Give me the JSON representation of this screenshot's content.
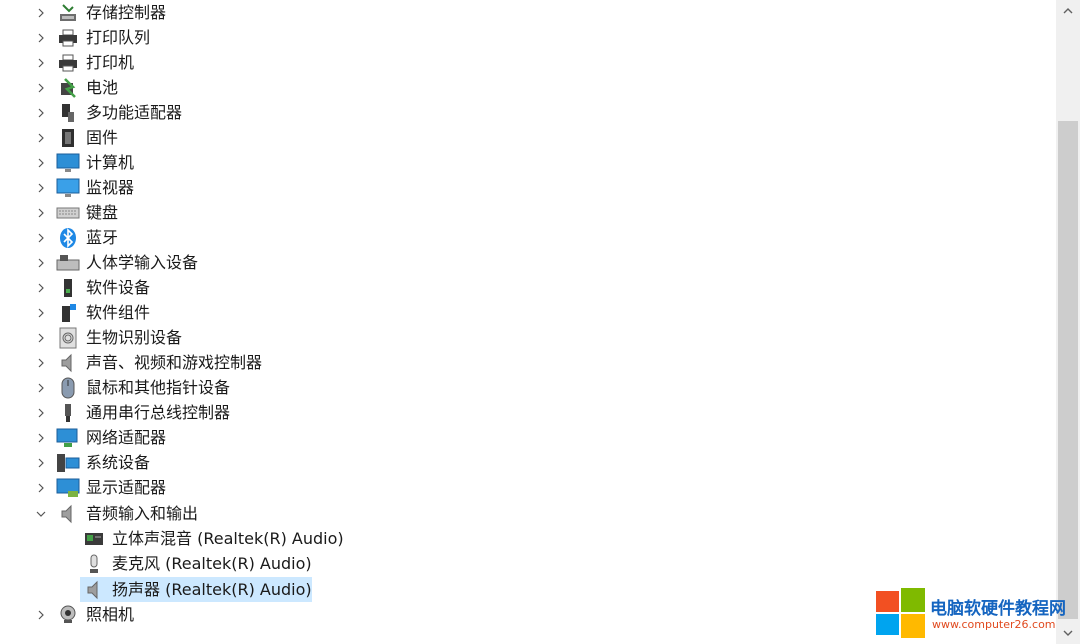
{
  "device_tree": {
    "categories": [
      {
        "label": "存储控制器",
        "icon": "storage-controller-icon",
        "expanded": false
      },
      {
        "label": "打印队列",
        "icon": "printer-icon",
        "expanded": false
      },
      {
        "label": "打印机",
        "icon": "printer-icon",
        "expanded": false
      },
      {
        "label": "电池",
        "icon": "battery-icon",
        "expanded": false
      },
      {
        "label": "多功能适配器",
        "icon": "multifunction-adapter-icon",
        "expanded": false
      },
      {
        "label": "固件",
        "icon": "firmware-icon",
        "expanded": false
      },
      {
        "label": "计算机",
        "icon": "computer-icon",
        "expanded": false
      },
      {
        "label": "监视器",
        "icon": "monitor-icon",
        "expanded": false
      },
      {
        "label": "键盘",
        "icon": "keyboard-icon",
        "expanded": false
      },
      {
        "label": "蓝牙",
        "icon": "bluetooth-icon",
        "expanded": false
      },
      {
        "label": "人体学输入设备",
        "icon": "hid-icon",
        "expanded": false
      },
      {
        "label": "软件设备",
        "icon": "software-device-icon",
        "expanded": false
      },
      {
        "label": "软件组件",
        "icon": "software-component-icon",
        "expanded": false
      },
      {
        "label": "生物识别设备",
        "icon": "fingerprint-icon",
        "expanded": false
      },
      {
        "label": "声音、视频和游戏控制器",
        "icon": "speaker-icon",
        "expanded": false
      },
      {
        "label": "鼠标和其他指针设备",
        "icon": "mouse-icon",
        "expanded": false
      },
      {
        "label": "通用串行总线控制器",
        "icon": "usb-icon",
        "expanded": false
      },
      {
        "label": "网络适配器",
        "icon": "network-adapter-icon",
        "expanded": false
      },
      {
        "label": "系统设备",
        "icon": "system-device-icon",
        "expanded": false
      },
      {
        "label": "显示适配器",
        "icon": "display-adapter-icon",
        "expanded": false
      },
      {
        "label": "音频输入和输出",
        "icon": "speaker-icon",
        "expanded": true,
        "children": [
          {
            "label": "立体声混音 (Realtek(R) Audio)",
            "icon": "sound-card-icon"
          },
          {
            "label": "麦克风 (Realtek(R) Audio)",
            "icon": "microphone-icon"
          },
          {
            "label": "扬声器 (Realtek(R) Audio)",
            "icon": "speaker-icon",
            "selected": true
          }
        ]
      },
      {
        "label": "照相机",
        "icon": "camera-icon",
        "expanded": false
      }
    ]
  },
  "watermark": {
    "title": "电脑软硬件教程网",
    "url": "www.computer26.com"
  },
  "colors": {
    "selection": "#cce8ff",
    "scrollbar_track": "#f0f0f0",
    "scrollbar_thumb": "#cdcdcd",
    "watermark_title": "#1565c0",
    "watermark_url": "#e04a1f"
  }
}
